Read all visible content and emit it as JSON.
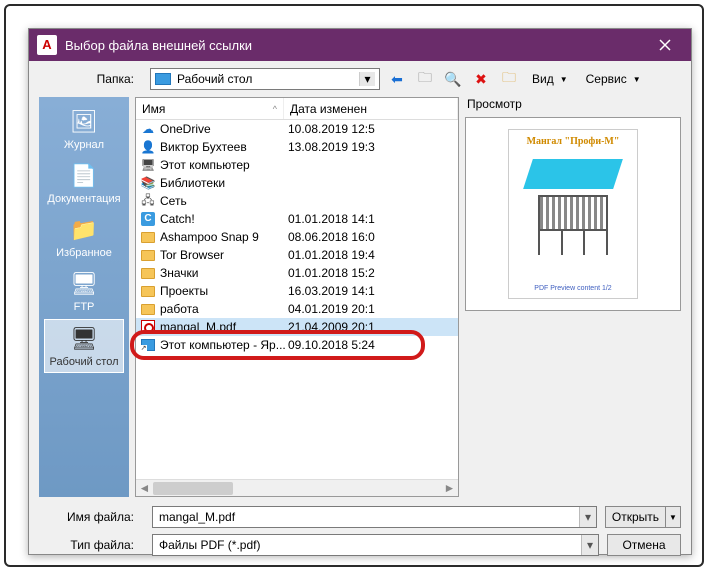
{
  "titlebar": {
    "app_icon_letter": "A",
    "title": "Выбор файла внешней ссылки"
  },
  "toolbar": {
    "folder_label": "Папка:",
    "folder_name": "Рабочий стол",
    "view_label": "Вид",
    "tools_label": "Сервис"
  },
  "places": [
    {
      "label": "Журнал",
      "icon": "🖼"
    },
    {
      "label": "Документация",
      "icon": "📄"
    },
    {
      "label": "Избранное",
      "icon": "📁"
    },
    {
      "label": "FTP",
      "icon": "🖥"
    },
    {
      "label": "Рабочий стол",
      "icon": "🖥",
      "selected": true
    }
  ],
  "columns": {
    "name": "Имя",
    "date": "Дата изменен"
  },
  "files": [
    {
      "icon": "cloud",
      "name": "OneDrive",
      "date": "10.08.2019 12:5"
    },
    {
      "icon": "user",
      "name": "Виктор Бухтеев",
      "date": "13.08.2019 19:3"
    },
    {
      "icon": "pc",
      "name": "Этот компьютер",
      "date": ""
    },
    {
      "icon": "lib",
      "name": "Библиотеки",
      "date": ""
    },
    {
      "icon": "net",
      "name": "Сеть",
      "date": ""
    },
    {
      "icon": "catch",
      "name": "Catch!",
      "date": "01.01.2018 14:1"
    },
    {
      "icon": "folder",
      "name": "Ashampoo Snap 9",
      "date": "08.06.2018 16:0"
    },
    {
      "icon": "folder",
      "name": "Tor Browser",
      "date": "01.01.2018 19:4"
    },
    {
      "icon": "folder",
      "name": "Значки",
      "date": "01.01.2018 15:2"
    },
    {
      "icon": "folder",
      "name": "Проекты",
      "date": "16.03.2019 14:1"
    },
    {
      "icon": "folder",
      "name": "работа",
      "date": "04.01.2019 20:1"
    },
    {
      "icon": "pdf",
      "name": "mangal_M.pdf",
      "date": "21.04.2009 20:1",
      "selected": true
    },
    {
      "icon": "short",
      "name": "Этот компьютер - Яр...",
      "date": "09.10.2018 5:24"
    }
  ],
  "preview": {
    "label": "Просмотр",
    "thumb_title": "Мангал \"Профи-М\"",
    "thumb_footer": "PDF Preview content 1/2"
  },
  "bottom": {
    "filename_label": "Имя файла:",
    "filename_value": "mangal_M.pdf",
    "filetype_label": "Тип файла:",
    "filetype_value": "Файлы PDF (*.pdf)",
    "open": "Открыть",
    "cancel": "Отмена"
  }
}
